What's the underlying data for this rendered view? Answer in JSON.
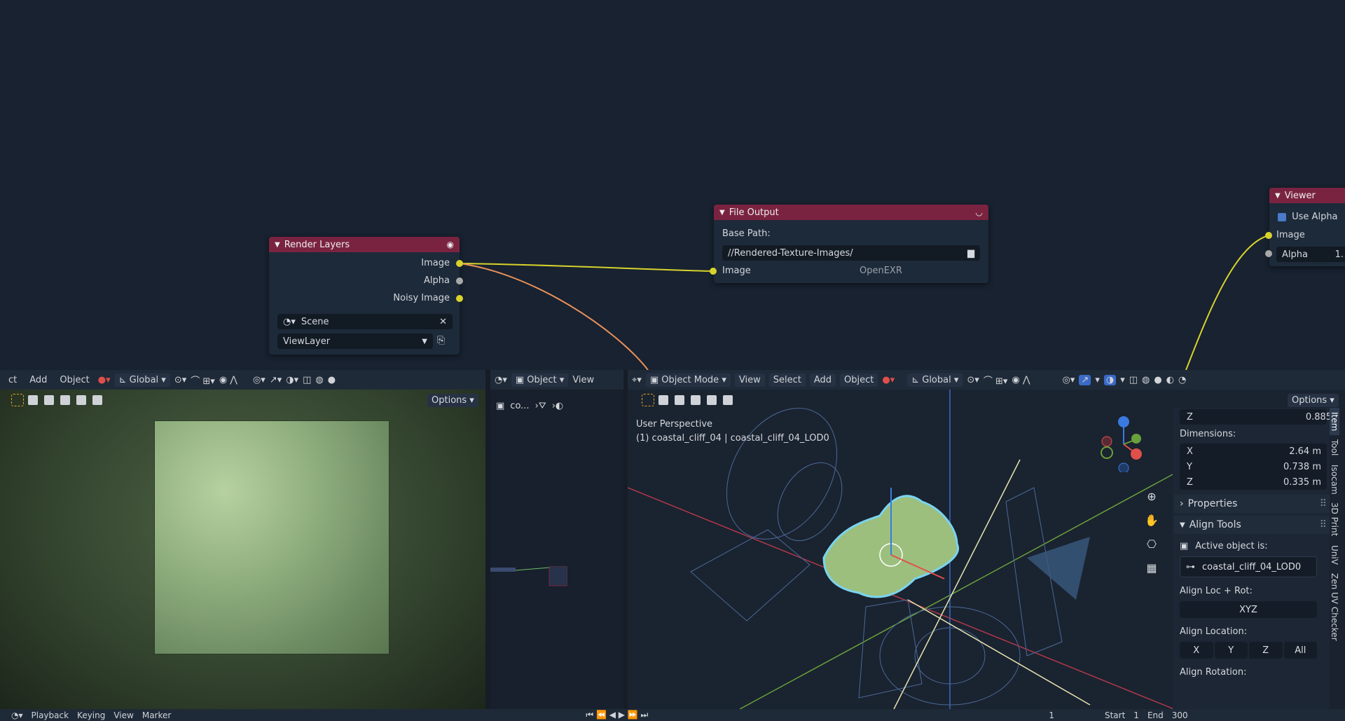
{
  "node_editor": {
    "render_layers": {
      "title": "Render Layers",
      "outputs": [
        "Image",
        "Alpha",
        "Noisy Image"
      ],
      "scene": "Scene",
      "view_layer": "ViewLayer"
    },
    "file_output": {
      "title": "File Output",
      "base_path_label": "Base Path:",
      "base_path": "//Rendered-Texture-Images/",
      "input_label": "Image",
      "format": "OpenEXR"
    },
    "viewer": {
      "title": "Viewer",
      "use_alpha": "Use Alpha",
      "input_image": "Image",
      "alpha_label": "Alpha",
      "alpha_value": "1."
    },
    "header_color": "#7a2340"
  },
  "uv_editor": {
    "header_items": [
      "ct",
      "Add",
      "Object"
    ],
    "transform": "Global",
    "options": "Options"
  },
  "outliner": {
    "mode": "Object",
    "view": "View",
    "item_label": "co..."
  },
  "viewport": {
    "mode": "Object Mode",
    "menu": [
      "View",
      "Select",
      "Add",
      "Object"
    ],
    "transform": "Global",
    "options": "Options",
    "perspective": "User Perspective",
    "object_info": "(1) coastal_cliff_04 | coastal_cliff_04_LOD0"
  },
  "n_panel": {
    "z_label": "Z",
    "z_value": "0.885",
    "dimensions_label": "Dimensions:",
    "dimensions": [
      {
        "axis": "X",
        "value": "2.64 m"
      },
      {
        "axis": "Y",
        "value": "0.738 m"
      },
      {
        "axis": "Z",
        "value": "0.335 m"
      }
    ],
    "properties": "Properties",
    "align_tools": "Align Tools",
    "active_object_label": "Active object is:",
    "active_object": "coastal_cliff_04_LOD0",
    "align_loc_rot": "Align Loc + Rot:",
    "xyz": "XYZ",
    "align_location": "Align Location:",
    "loc_buttons": [
      "X",
      "Y",
      "Z",
      "All"
    ],
    "align_rotation": "Align Rotation:"
  },
  "side_tabs": [
    "Item",
    "Tool",
    "Isocam",
    "3D Print",
    "UniV",
    "Zen UV Checker"
  ],
  "timeline": {
    "items": [
      "Playback",
      "Keying",
      "View",
      "Marker"
    ],
    "frame": "1",
    "start_label": "Start",
    "start": "1",
    "end_label": "End",
    "end": "300"
  }
}
